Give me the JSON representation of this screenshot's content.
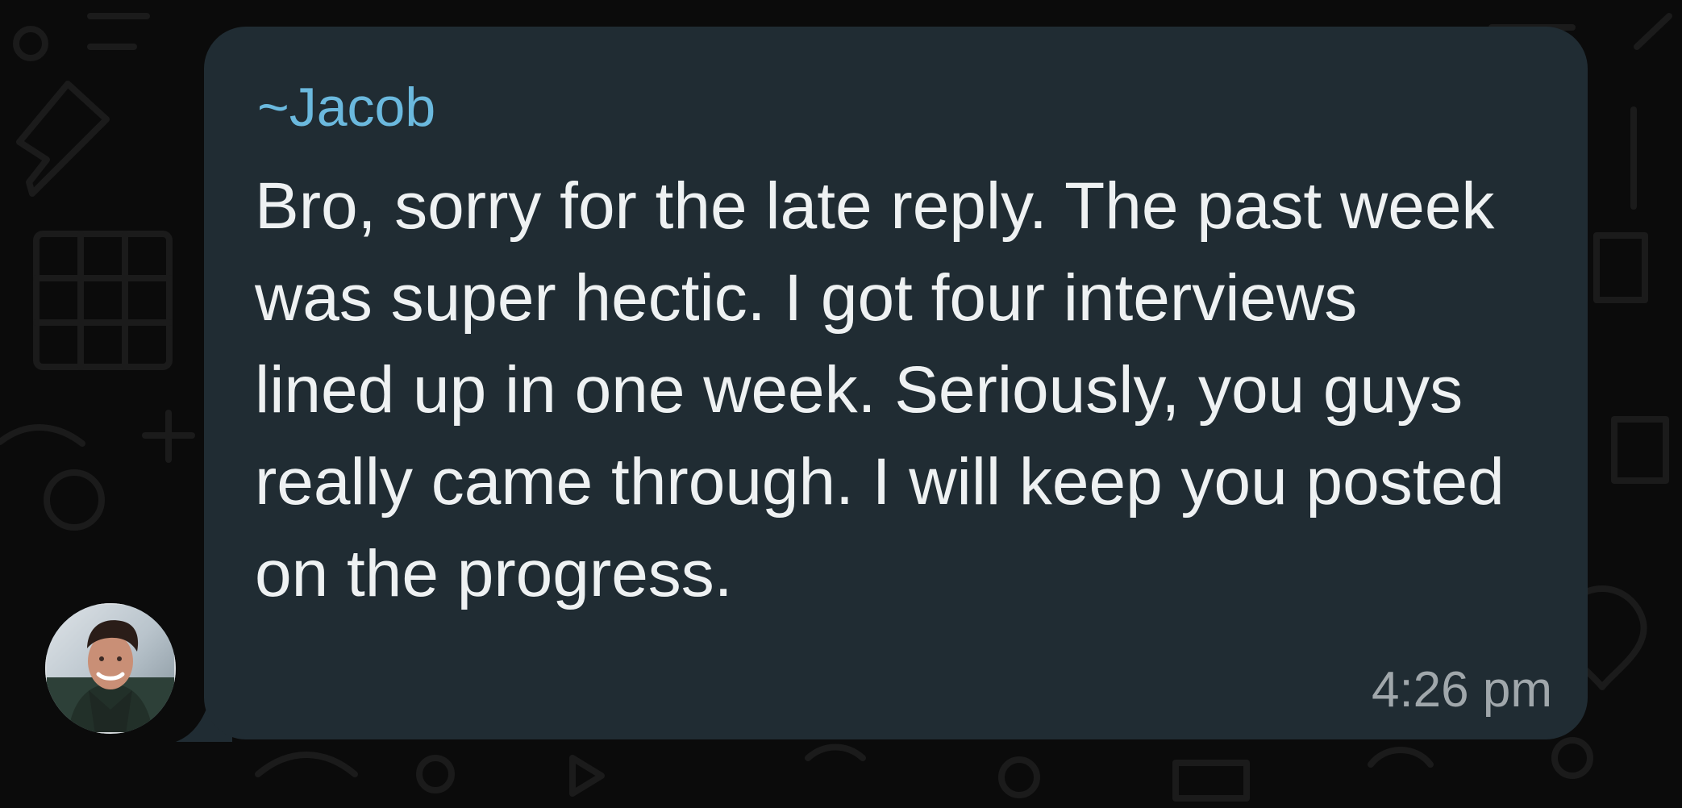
{
  "chat": {
    "message": {
      "sender": "~Jacob",
      "text": "Bro, sorry for the late reply. The past week was super hectic. I got four interviews lined up in one week. Seriously, you guys really came through. I will keep you posted on the progress.",
      "time": "4:26 pm"
    }
  },
  "colors": {
    "background": "#0b0b0b",
    "bubble": "#202c33",
    "sender_name": "#6bb9de",
    "message_text": "#eef1f2",
    "timestamp": "#a0a7ab"
  },
  "icons": {
    "avatar": "profile-photo",
    "wallpaper": "doodle-pattern"
  }
}
